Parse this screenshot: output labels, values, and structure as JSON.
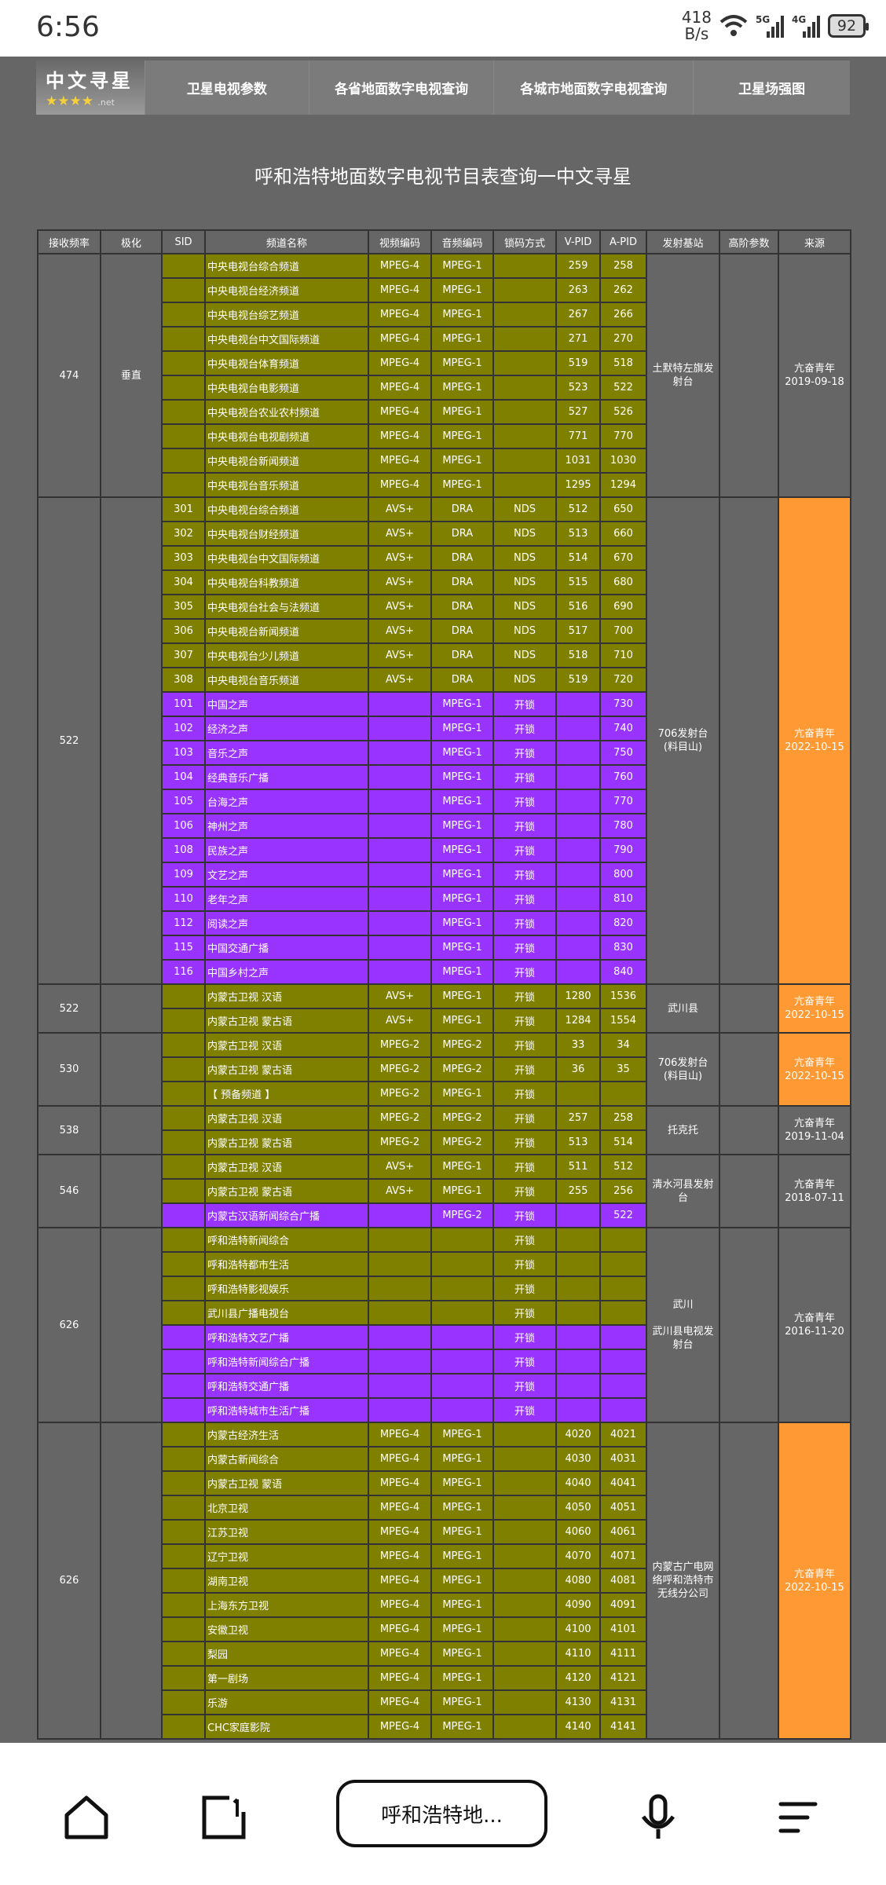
{
  "status": {
    "time": "6:56",
    "netspeed_value": "418",
    "netspeed_unit": "B/s",
    "sim1": "5G",
    "sim2": "4G",
    "battery": "92"
  },
  "header": {
    "logo_text": "中文寻星",
    "logo_suffix": ".net",
    "nav": [
      "卫星电视参数",
      "各省地面数字电视查询",
      "各城市地面数字电视查询",
      "卫星场强图"
    ]
  },
  "page_title": "呼和浩特地面数字电视节目表查询一中文寻星",
  "colors": {
    "tv": "#808000",
    "radio": "#9933ff",
    "highlight": "#ff9933",
    "background": "#666666"
  },
  "table": {
    "headers": [
      "接收频率",
      "极化",
      "SID",
      "频道名称",
      "视频编码",
      "音频编码",
      "锁码方式",
      "V-PID",
      "A-PID",
      "发射基站",
      "高阶参数",
      "来源"
    ],
    "groups": [
      {
        "freq": "474",
        "pol": "垂直",
        "station": [
          "土默特左旗发射台"
        ],
        "params": "",
        "source": [
          "亢奋青年",
          "2019-09-18"
        ],
        "highlight": false,
        "rows": [
          [
            "",
            "中央电视台综合频道",
            "MPEG-4",
            "MPEG-1",
            "",
            "259",
            "258",
            "tv"
          ],
          [
            "",
            "中央电视台经济频道",
            "MPEG-4",
            "MPEG-1",
            "",
            "263",
            "262",
            "tv"
          ],
          [
            "",
            "中央电视台综艺频道",
            "MPEG-4",
            "MPEG-1",
            "",
            "267",
            "266",
            "tv"
          ],
          [
            "",
            "中央电视台中文国际频道",
            "MPEG-4",
            "MPEG-1",
            "",
            "271",
            "270",
            "tv"
          ],
          [
            "",
            "中央电视台体育频道",
            "MPEG-4",
            "MPEG-1",
            "",
            "519",
            "518",
            "tv"
          ],
          [
            "",
            "中央电视台电影频道",
            "MPEG-4",
            "MPEG-1",
            "",
            "523",
            "522",
            "tv"
          ],
          [
            "",
            "中央电视台农业农村频道",
            "MPEG-4",
            "MPEG-1",
            "",
            "527",
            "526",
            "tv"
          ],
          [
            "",
            "中央电视台电视剧频道",
            "MPEG-4",
            "MPEG-1",
            "",
            "771",
            "770",
            "tv"
          ],
          [
            "",
            "中央电视台新闻频道",
            "MPEG-4",
            "MPEG-1",
            "",
            "1031",
            "1030",
            "tv"
          ],
          [
            "",
            "中央电视台音乐频道",
            "MPEG-4",
            "MPEG-1",
            "",
            "1295",
            "1294",
            "tv"
          ]
        ]
      },
      {
        "freq": "522",
        "pol": "",
        "station": [
          "706发射台",
          "(料目山)"
        ],
        "params": "",
        "source": [
          "亢奋青年",
          "2022-10-15"
        ],
        "highlight": true,
        "rows": [
          [
            "301",
            "中央电视台综合频道",
            "AVS+",
            "DRA",
            "NDS",
            "512",
            "650",
            "tv"
          ],
          [
            "302",
            "中央电视台财经频道",
            "AVS+",
            "DRA",
            "NDS",
            "513",
            "660",
            "tv"
          ],
          [
            "303",
            "中央电视台中文国际频道",
            "AVS+",
            "DRA",
            "NDS",
            "514",
            "670",
            "tv"
          ],
          [
            "304",
            "中央电视台科教频道",
            "AVS+",
            "DRA",
            "NDS",
            "515",
            "680",
            "tv"
          ],
          [
            "305",
            "中央电视台社会与法频道",
            "AVS+",
            "DRA",
            "NDS",
            "516",
            "690",
            "tv"
          ],
          [
            "306",
            "中央电视台新闻频道",
            "AVS+",
            "DRA",
            "NDS",
            "517",
            "700",
            "tv"
          ],
          [
            "307",
            "中央电视台少儿频道",
            "AVS+",
            "DRA",
            "NDS",
            "518",
            "710",
            "tv"
          ],
          [
            "308",
            "中央电视台音乐频道",
            "AVS+",
            "DRA",
            "NDS",
            "519",
            "720",
            "tv"
          ],
          [
            "101",
            "中国之声",
            "",
            "MPEG-1",
            "开锁",
            "",
            "730",
            "radio"
          ],
          [
            "102",
            "经济之声",
            "",
            "MPEG-1",
            "开锁",
            "",
            "740",
            "radio"
          ],
          [
            "103",
            "音乐之声",
            "",
            "MPEG-1",
            "开锁",
            "",
            "750",
            "radio"
          ],
          [
            "104",
            "经典音乐广播",
            "",
            "MPEG-1",
            "开锁",
            "",
            "760",
            "radio"
          ],
          [
            "105",
            "台海之声",
            "",
            "MPEG-1",
            "开锁",
            "",
            "770",
            "radio"
          ],
          [
            "106",
            "神州之声",
            "",
            "MPEG-1",
            "开锁",
            "",
            "780",
            "radio"
          ],
          [
            "108",
            "民族之声",
            "",
            "MPEG-1",
            "开锁",
            "",
            "790",
            "radio"
          ],
          [
            "109",
            "文艺之声",
            "",
            "MPEG-1",
            "开锁",
            "",
            "800",
            "radio"
          ],
          [
            "110",
            "老年之声",
            "",
            "MPEG-1",
            "开锁",
            "",
            "810",
            "radio"
          ],
          [
            "112",
            "阅读之声",
            "",
            "MPEG-1",
            "开锁",
            "",
            "820",
            "radio"
          ],
          [
            "115",
            "中国交通广播",
            "",
            "MPEG-1",
            "开锁",
            "",
            "830",
            "radio"
          ],
          [
            "116",
            "中国乡村之声",
            "",
            "MPEG-1",
            "开锁",
            "",
            "840",
            "radio"
          ]
        ]
      },
      {
        "freq": "522",
        "pol": "",
        "station": [
          "武川县"
        ],
        "params": "",
        "source": [
          "亢奋青年",
          "2022-10-15"
        ],
        "highlight": true,
        "rows": [
          [
            "",
            "内蒙古卫视 汉语",
            "AVS+",
            "MPEG-1",
            "开锁",
            "1280",
            "1536",
            "tv"
          ],
          [
            "",
            "内蒙古卫视 蒙古语",
            "AVS+",
            "MPEG-1",
            "开锁",
            "1284",
            "1554",
            "tv"
          ]
        ]
      },
      {
        "freq": "530",
        "pol": "",
        "station": [
          "706发射台",
          "(料目山)"
        ],
        "params": "",
        "source": [
          "亢奋青年",
          "2022-10-15"
        ],
        "highlight": true,
        "rows": [
          [
            "",
            "内蒙古卫视 汉语",
            "MPEG-2",
            "MPEG-2",
            "开锁",
            "33",
            "34",
            "tv"
          ],
          [
            "",
            "内蒙古卫视 蒙古语",
            "MPEG-2",
            "MPEG-2",
            "开锁",
            "36",
            "35",
            "tv"
          ],
          [
            "",
            "【 预备频道 】",
            "MPEG-2",
            "MPEG-1",
            "开锁",
            "",
            "",
            "tv"
          ]
        ]
      },
      {
        "freq": "538",
        "pol": "",
        "station": [
          "托克托"
        ],
        "params": "",
        "source": [
          "亢奋青年",
          "2019-11-04"
        ],
        "highlight": false,
        "rows": [
          [
            "",
            "内蒙古卫视 汉语",
            "MPEG-2",
            "MPEG-2",
            "开锁",
            "257",
            "258",
            "tv"
          ],
          [
            "",
            "内蒙古卫视 蒙古语",
            "MPEG-2",
            "MPEG-2",
            "开锁",
            "513",
            "514",
            "tv"
          ]
        ]
      },
      {
        "freq": "546",
        "pol": "",
        "station": [
          "清水河县发射台"
        ],
        "params": "",
        "source": [
          "亢奋青年",
          "2018-07-11"
        ],
        "highlight": false,
        "rows": [
          [
            "",
            "内蒙古卫视 汉语",
            "AVS+",
            "MPEG-1",
            "开锁",
            "511",
            "512",
            "tv"
          ],
          [
            "",
            "内蒙古卫视 蒙古语",
            "AVS+",
            "MPEG-1",
            "开锁",
            "255",
            "256",
            "tv"
          ],
          [
            "",
            "内蒙古汉语新闻综合广播",
            "",
            "MPEG-2",
            "开锁",
            "",
            "522",
            "radio"
          ]
        ]
      },
      {
        "freq": "626",
        "pol": "",
        "station": [
          "武川",
          "",
          "武川县电视发射台"
        ],
        "params": "",
        "source": [
          "亢奋青年",
          "2016-11-20"
        ],
        "highlight": false,
        "rows": [
          [
            "",
            "呼和浩特新闻综合",
            "",
            "",
            "开锁",
            "",
            "",
            "tv"
          ],
          [
            "",
            "呼和浩特都市生活",
            "",
            "",
            "开锁",
            "",
            "",
            "tv"
          ],
          [
            "",
            "呼和浩特影视娱乐",
            "",
            "",
            "开锁",
            "",
            "",
            "tv"
          ],
          [
            "",
            "武川县广播电视台",
            "",
            "",
            "开锁",
            "",
            "",
            "tv"
          ],
          [
            "",
            "呼和浩特文艺广播",
            "",
            "",
            "开锁",
            "",
            "",
            "radio"
          ],
          [
            "",
            "呼和浩特新闻综合广播",
            "",
            "",
            "开锁",
            "",
            "",
            "radio"
          ],
          [
            "",
            "呼和浩特交通广播",
            "",
            "",
            "开锁",
            "",
            "",
            "radio"
          ],
          [
            "",
            "呼和浩特城市生活广播",
            "",
            "",
            "开锁",
            "",
            "",
            "radio"
          ]
        ]
      },
      {
        "freq": "626",
        "pol": "",
        "station": [
          "内蒙古广电网络呼和浩特市无线分公司"
        ],
        "params": "",
        "source": [
          "亢奋青年",
          "2022-10-15"
        ],
        "highlight": true,
        "rows": [
          [
            "",
            "内蒙古经济生活",
            "MPEG-4",
            "MPEG-1",
            "",
            "4020",
            "4021",
            "tv"
          ],
          [
            "",
            "内蒙古新闻综合",
            "MPEG-4",
            "MPEG-1",
            "",
            "4030",
            "4031",
            "tv"
          ],
          [
            "",
            "内蒙古卫视 蒙语",
            "MPEG-4",
            "MPEG-1",
            "",
            "4040",
            "4041",
            "tv"
          ],
          [
            "",
            "北京卫视",
            "MPEG-4",
            "MPEG-1",
            "",
            "4050",
            "4051",
            "tv"
          ],
          [
            "",
            "江苏卫视",
            "MPEG-4",
            "MPEG-1",
            "",
            "4060",
            "4061",
            "tv"
          ],
          [
            "",
            "辽宁卫视",
            "MPEG-4",
            "MPEG-1",
            "",
            "4070",
            "4071",
            "tv"
          ],
          [
            "",
            "湖南卫视",
            "MPEG-4",
            "MPEG-1",
            "",
            "4080",
            "4081",
            "tv"
          ],
          [
            "",
            "上海东方卫视",
            "MPEG-4",
            "MPEG-1",
            "",
            "4090",
            "4091",
            "tv"
          ],
          [
            "",
            "安徽卫视",
            "MPEG-4",
            "MPEG-1",
            "",
            "4100",
            "4101",
            "tv"
          ],
          [
            "",
            "梨园",
            "MPEG-4",
            "MPEG-1",
            "",
            "4110",
            "4111",
            "tv"
          ],
          [
            "",
            "第一剧场",
            "MPEG-4",
            "MPEG-1",
            "",
            "4120",
            "4121",
            "tv"
          ],
          [
            "",
            "乐游",
            "MPEG-4",
            "MPEG-1",
            "",
            "4130",
            "4131",
            "tv"
          ],
          [
            "",
            "CHC家庭影院",
            "MPEG-4",
            "MPEG-1",
            "",
            "4140",
            "4141",
            "tv"
          ]
        ]
      }
    ]
  },
  "bottom_nav": {
    "address_text": "呼和浩特地..."
  }
}
